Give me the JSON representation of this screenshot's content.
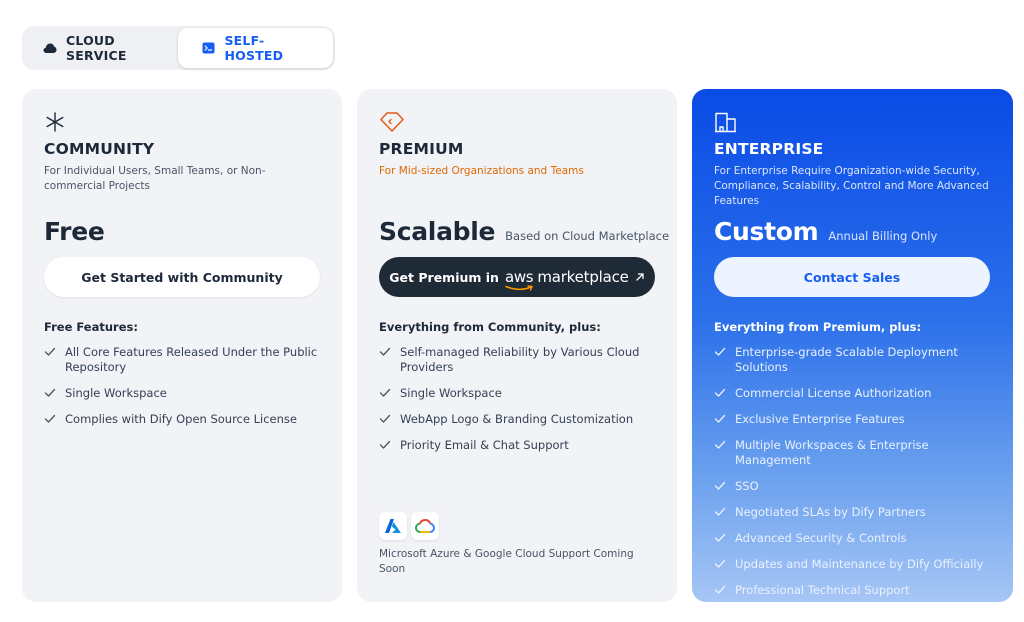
{
  "tabs": [
    {
      "label": "CLOUD SERVICE",
      "icon": "cloud-icon",
      "active": false
    },
    {
      "label": "SELF-HOSTED",
      "icon": "terminal-icon",
      "active": true
    }
  ],
  "plans": [
    {
      "name": "COMMUNITY",
      "icon": "asterisk-icon",
      "description": "For Individual Users, Small Teams, or Non-commercial Projects",
      "price": "Free",
      "price_note": "",
      "cta": "Get Started with Community",
      "features_title": "Free Features:",
      "features": [
        "All Core Features Released Under the Public Repository",
        "Single Workspace",
        "Complies with Dify Open Source License"
      ]
    },
    {
      "name": "PREMIUM",
      "icon": "diamond-tag-icon",
      "description": "For Mid-sized Organizations and Teams",
      "price": "Scalable",
      "price_note": "Based on Cloud Marketplace",
      "cta_prefix": "Get Premium in",
      "cta_aws": "aws",
      "cta_marketplace": "marketplace",
      "features_title": "Everything from Community, plus:",
      "features": [
        "Self-managed Reliability by Various Cloud Providers",
        "Single Workspace",
        "WebApp Logo & Branding Customization",
        "Priority Email & Chat Support"
      ],
      "cloud_logos": [
        "azure-logo",
        "google-cloud-logo"
      ],
      "coming_soon": "Microsoft Azure & Google Cloud Support Coming Soon"
    },
    {
      "name": "ENTERPRISE",
      "icon": "building-icon",
      "description": "For Enterprise Require Organization-wide Security, Compliance, Scalability, Control and More Advanced Features",
      "price": "Custom",
      "price_note": "Annual Billing Only",
      "cta": "Contact Sales",
      "features_title": "Everything from Premium, plus:",
      "features": [
        "Enterprise-grade Scalable Deployment Solutions",
        "Commercial License Authorization",
        "Exclusive Enterprise Features",
        "Multiple Workspaces & Enterprise Management",
        "SSO",
        "Negotiated SLAs by Dify Partners",
        "Advanced Security & Controls",
        "Updates and Maintenance by Dify Officially",
        "Professional Technical Support"
      ]
    }
  ],
  "colors": {
    "accent": "#155eef",
    "premium_desc": "#dc6803",
    "enterprise_top": "#0a4be6",
    "enterprise_bottom": "#a6c6f5",
    "dark_button": "#1f2a37"
  }
}
